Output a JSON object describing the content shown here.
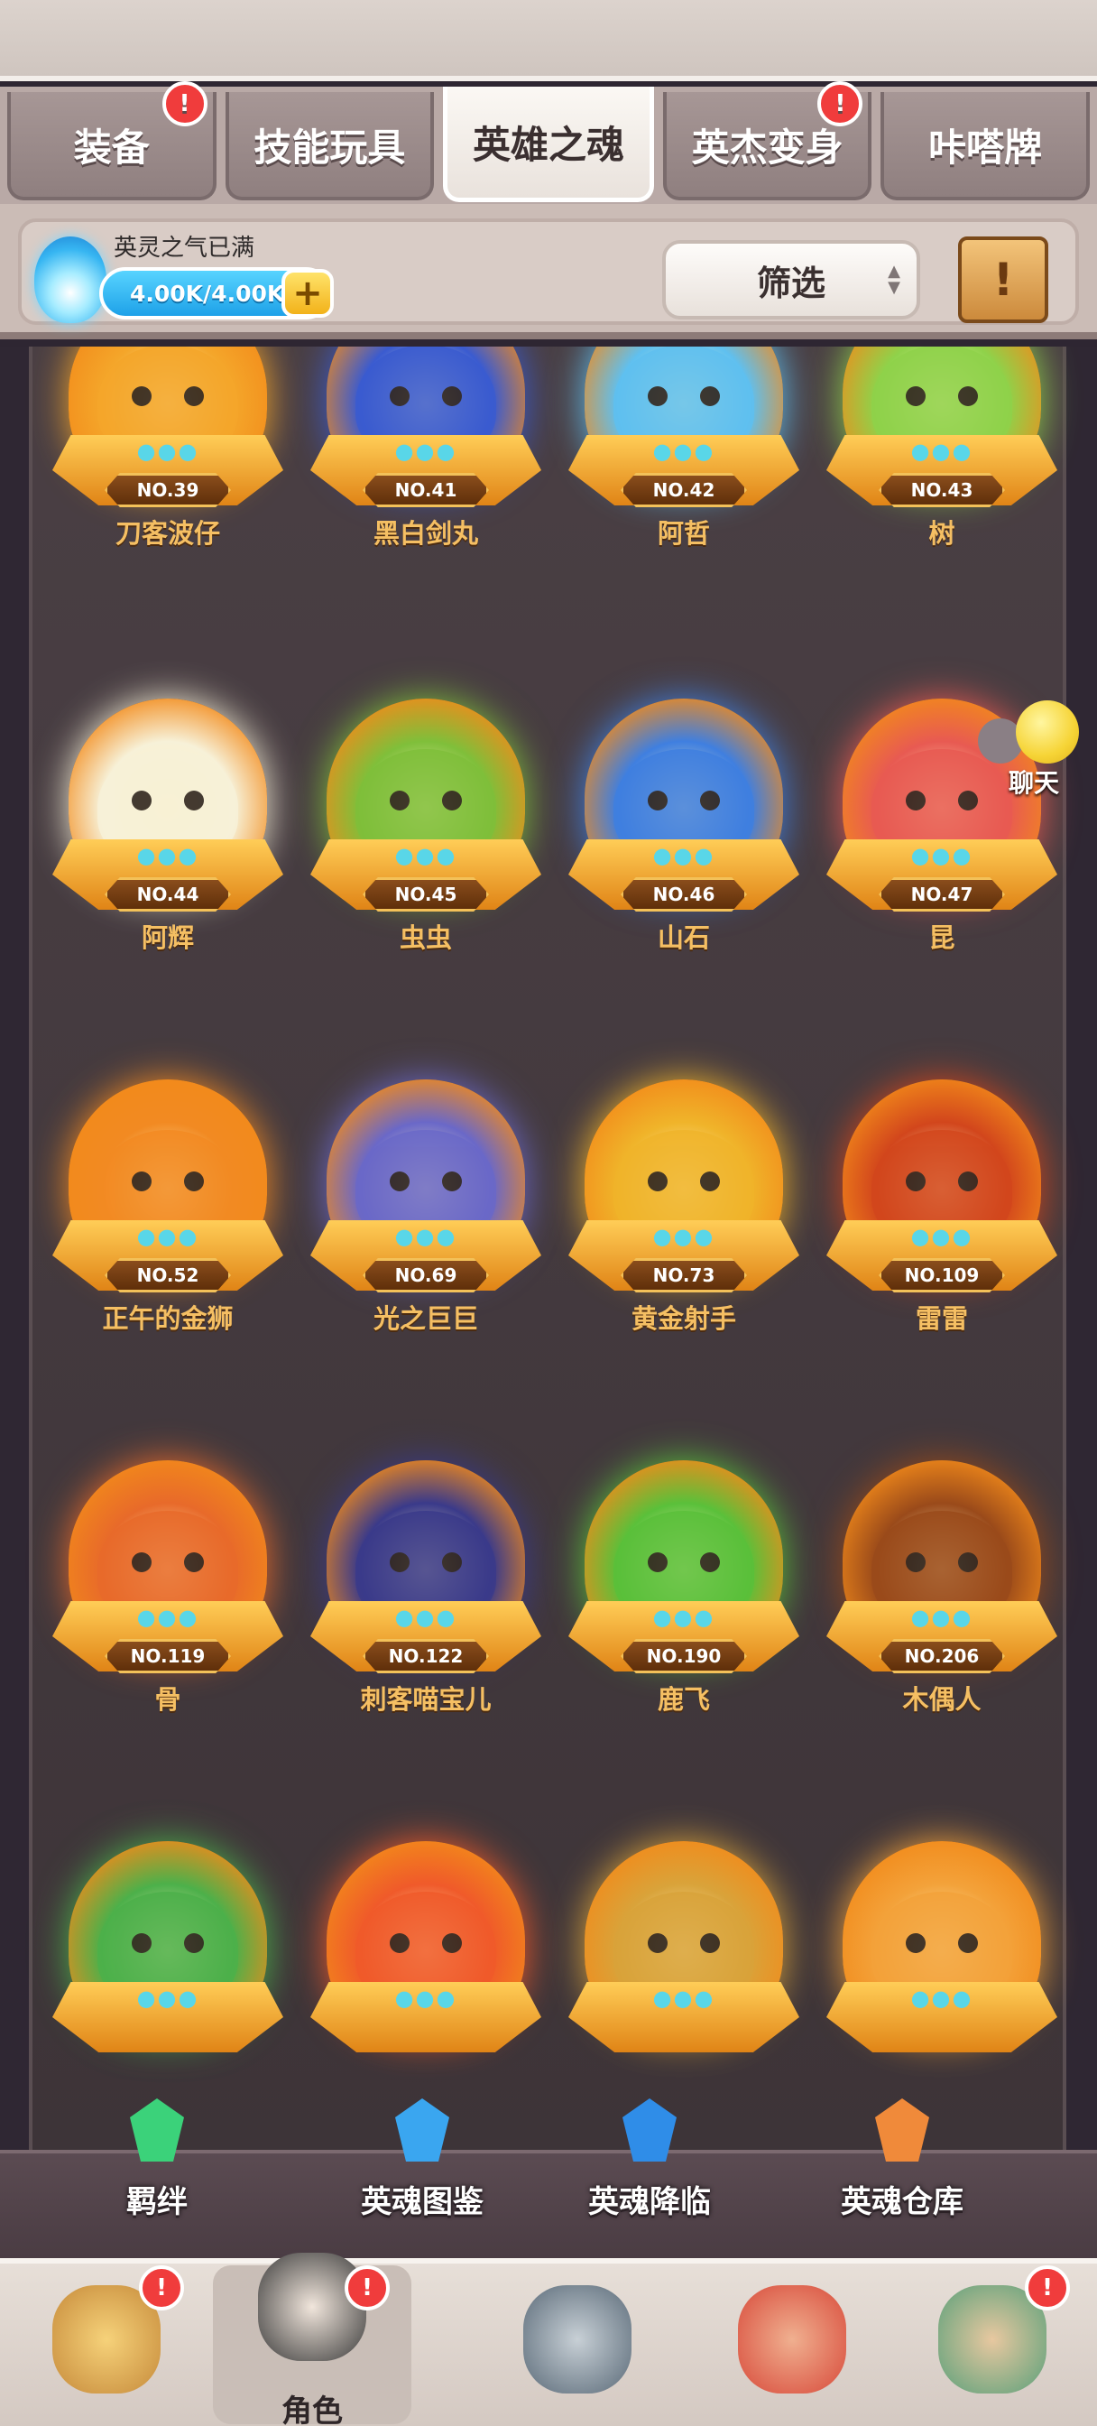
{
  "tabs": [
    {
      "label": "装备",
      "active": false,
      "alert": true
    },
    {
      "label": "技能玩具",
      "active": false,
      "alert": false
    },
    {
      "label": "英雄之魂",
      "active": true,
      "alert": false
    },
    {
      "label": "英杰变身",
      "active": false,
      "alert": true
    },
    {
      "label": "咔嗒牌",
      "active": false,
      "alert": false
    }
  ],
  "resource": {
    "title": "英灵之气已满",
    "value": "4.00K/4.00K",
    "add_icon": "plus-icon",
    "icon": "blue-flame-icon"
  },
  "filter": {
    "label": "筛选",
    "icon": "sort-arrows-icon"
  },
  "scroll_button": {
    "icon": "scroll-exclamation-icon"
  },
  "heroes": [
    {
      "no": "NO.39",
      "name": "刀客波仔",
      "stars": "●●●",
      "color": "#f4a62a"
    },
    {
      "no": "NO.41",
      "name": "黑白剑丸",
      "stars": "●●●",
      "color": "#3a5bd0"
    },
    {
      "no": "NO.42",
      "name": "阿哲",
      "stars": "●●●",
      "color": "#5fc0f0"
    },
    {
      "no": "NO.43",
      "name": "树",
      "stars": "●●●",
      "color": "#8fd24a"
    },
    {
      "no": "NO.44",
      "name": "阿辉",
      "stars": "●●●",
      "color": "#f7f1d8"
    },
    {
      "no": "NO.45",
      "name": "虫虫",
      "stars": "●●●",
      "color": "#7fbf3a"
    },
    {
      "no": "NO.46",
      "name": "山石",
      "stars": "●●●",
      "color": "#3f7fe0"
    },
    {
      "no": "NO.47",
      "name": "昆",
      "stars": "●●●",
      "color": "#e85a52"
    },
    {
      "no": "NO.52",
      "name": "正午的金狮",
      "stars": "●●●",
      "color": "#f28a22"
    },
    {
      "no": "NO.69",
      "name": "光之巨巨",
      "stars": "●●●",
      "color": "#6a68c8"
    },
    {
      "no": "NO.73",
      "name": "黄金射手",
      "stars": "●●●",
      "color": "#f0b42a"
    },
    {
      "no": "NO.109",
      "name": "雷雷",
      "stars": "●●●",
      "color": "#d2461c"
    },
    {
      "no": "NO.119",
      "name": "骨",
      "stars": "●●●",
      "color": "#e86a2a"
    },
    {
      "no": "NO.122",
      "name": "刺客喵宝儿",
      "stars": "●●●",
      "color": "#3a3a8a"
    },
    {
      "no": "NO.190",
      "name": "鹿飞",
      "stars": "●●●",
      "color": "#5ac03a"
    },
    {
      "no": "NO.206",
      "name": "木偶人",
      "stars": "●●●",
      "color": "#9a4a1a"
    },
    {
      "no": "",
      "name": "",
      "stars": "●●●",
      "color": "#4cb04a"
    },
    {
      "no": "",
      "name": "",
      "stars": "●●●",
      "color": "#f05a2a"
    },
    {
      "no": "",
      "name": "",
      "stars": "●●●",
      "color": "#d9a33a"
    },
    {
      "no": "",
      "name": "",
      "stars": "●●●",
      "color": "#f3a23a"
    }
  ],
  "chat": {
    "label": "聊天",
    "icon": "chat-emoji-icon"
  },
  "actions": [
    {
      "label": "羁绊",
      "icon": "green-crystal-icon",
      "color": "#3bd27a"
    },
    {
      "label": "英魂图鉴",
      "icon": "blue-crystal-book-icon",
      "color": "#3aa6f0"
    },
    {
      "label": "英魂降临",
      "icon": "blue-crystal-altar-icon",
      "color": "#2f8de8"
    },
    {
      "label": "英魂仓库",
      "icon": "orange-crystal-icon",
      "color": "#f08a3a"
    }
  ],
  "nav": [
    {
      "label": "",
      "icon": "hero-avatar-icon",
      "alert": true,
      "active": false
    },
    {
      "label": "角色",
      "icon": "role-avatar-icon",
      "alert": true,
      "active": true
    },
    {
      "label": "",
      "icon": "sword-shield-icon",
      "alert": false,
      "active": false
    },
    {
      "label": "",
      "icon": "dragon-pet-icon",
      "alert": false,
      "active": false
    },
    {
      "label": "",
      "icon": "guild-castle-icon",
      "alert": true,
      "active": false
    }
  ],
  "alert_glyph": "!"
}
